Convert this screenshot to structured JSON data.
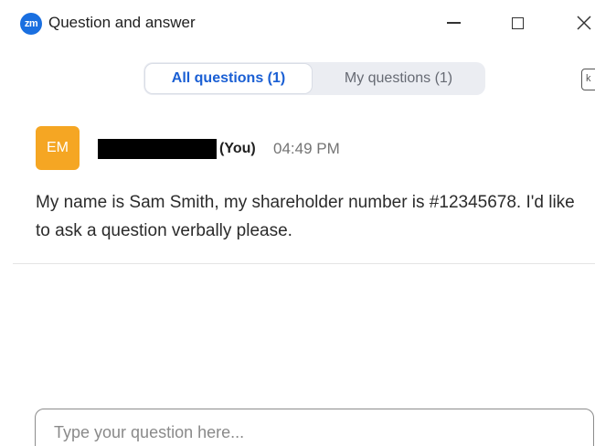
{
  "window": {
    "title": "Question and answer",
    "logo_text": "zm",
    "controls": {
      "minimize": "minimize-icon",
      "maximize": "maximize-icon",
      "close": "close-icon"
    }
  },
  "tabs": [
    {
      "label": "All questions (1)",
      "selected": true
    },
    {
      "label": "My questions (1)",
      "selected": false
    }
  ],
  "sort_button_glyph": "k",
  "questions": [
    {
      "avatar_initials": "EM",
      "avatar_color": "#f5a623",
      "name_redacted": true,
      "you_label": "(You)",
      "time": "04:49 PM",
      "text": "My name is Sam Smith, my shareholder number is #12345678. I'd like to ask a question verbally please."
    }
  ],
  "input": {
    "placeholder": "Type your question here...",
    "value": ""
  },
  "colors": {
    "accent": "#1a5fd4",
    "logo": "#1a6fe0",
    "avatar": "#f5a623"
  }
}
